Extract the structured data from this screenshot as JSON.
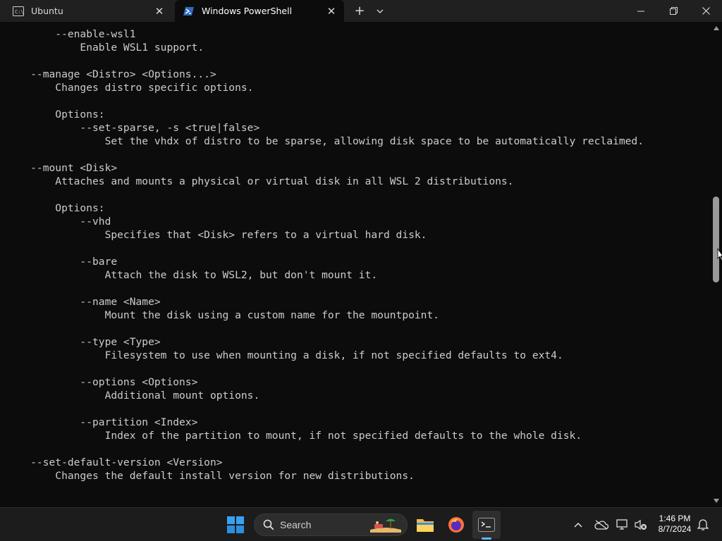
{
  "tabs": [
    {
      "label": "Ubuntu",
      "icon": "terminal-app-icon",
      "active": false
    },
    {
      "label": "Windows PowerShell",
      "icon": "powershell-icon",
      "active": true
    }
  ],
  "window_controls": {
    "minimize": "minimize-icon",
    "maximize": "restore-icon",
    "close": "close-icon"
  },
  "terminal": {
    "lines": [
      "        --enable-wsl1",
      "            Enable WSL1 support.",
      "",
      "    --manage <Distro> <Options...>",
      "        Changes distro specific options.",
      "",
      "        Options:",
      "            --set-sparse, -s <true|false>",
      "                Set the vhdx of distro to be sparse, allowing disk space to be automatically reclaimed.",
      "",
      "    --mount <Disk>",
      "        Attaches and mounts a physical or virtual disk in all WSL 2 distributions.",
      "",
      "        Options:",
      "            --vhd",
      "                Specifies that <Disk> refers to a virtual hard disk.",
      "",
      "            --bare",
      "                Attach the disk to WSL2, but don't mount it.",
      "",
      "            --name <Name>",
      "                Mount the disk using a custom name for the mountpoint.",
      "",
      "            --type <Type>",
      "                Filesystem to use when mounting a disk, if not specified defaults to ext4.",
      "",
      "            --options <Options>",
      "                Additional mount options.",
      "",
      "            --partition <Index>",
      "                Index of the partition to mount, if not specified defaults to the whole disk.",
      "",
      "    --set-default-version <Version>",
      "        Changes the default install version for new distributions.",
      ""
    ]
  },
  "taskbar": {
    "search_label": "Search",
    "apps": [
      "windows-start-icon",
      "file-explorer-icon",
      "firefox-icon",
      "terminal-icon"
    ],
    "clock": {
      "time": "1:46 PM",
      "date": "8/7/2024"
    }
  },
  "colors": {
    "terminal_bg": "#0c0c0c",
    "text": "#cccccc",
    "accent": "#5cb8ff"
  }
}
